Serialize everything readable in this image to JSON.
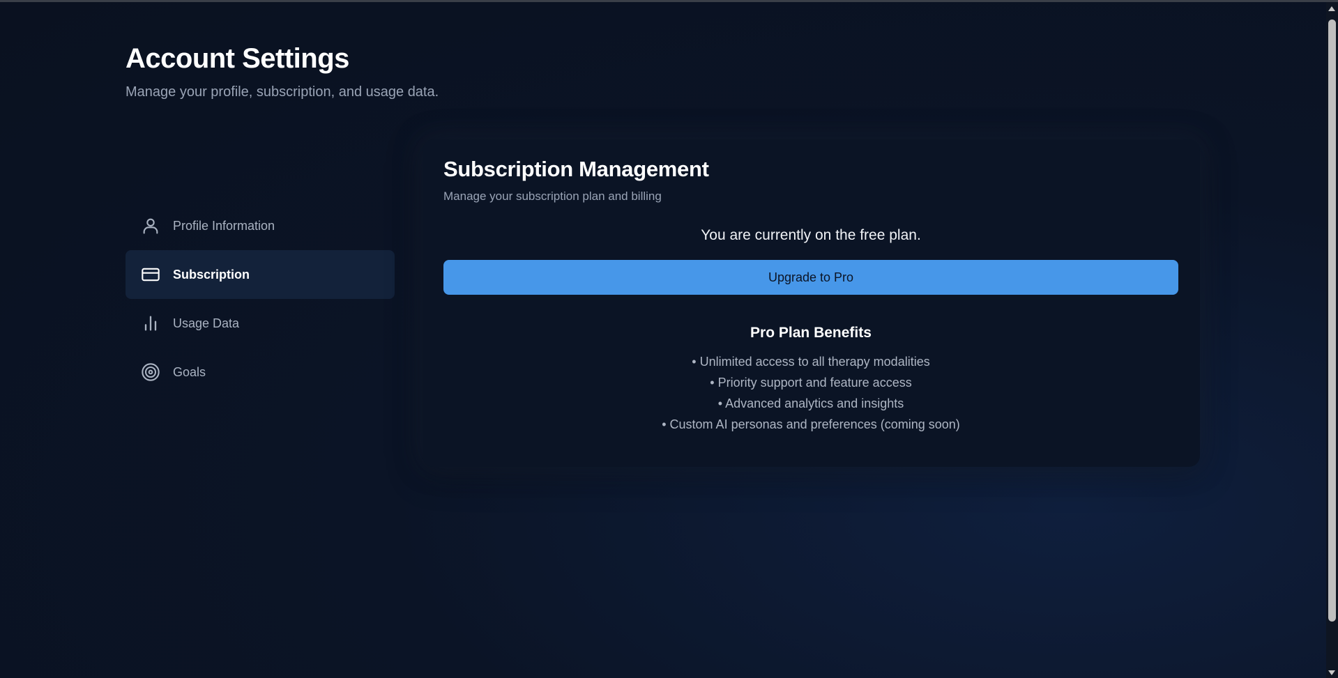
{
  "page": {
    "title": "Account Settings",
    "subtitle": "Manage your profile, subscription, and usage data."
  },
  "sidebar": {
    "items": [
      {
        "label": "Profile Information",
        "icon": "user-icon",
        "active": false
      },
      {
        "label": "Subscription",
        "icon": "credit-card-icon",
        "active": true
      },
      {
        "label": "Usage Data",
        "icon": "bar-chart-icon",
        "active": false
      },
      {
        "label": "Goals",
        "icon": "target-icon",
        "active": false
      }
    ]
  },
  "subscription": {
    "title": "Subscription Management",
    "subtitle": "Manage your subscription plan and billing",
    "status": "You are currently on the free plan.",
    "upgrade_label": "Upgrade to Pro",
    "benefits_title": "Pro Plan Benefits",
    "benefits": [
      "• Unlimited access to all therapy modalities",
      "• Priority support and feature access",
      "• Advanced analytics and insights",
      "• Custom AI personas and preferences (coming soon)"
    ]
  },
  "colors": {
    "accent": "#4797e9",
    "background": "#0b1426",
    "active_nav": "#13223a"
  }
}
